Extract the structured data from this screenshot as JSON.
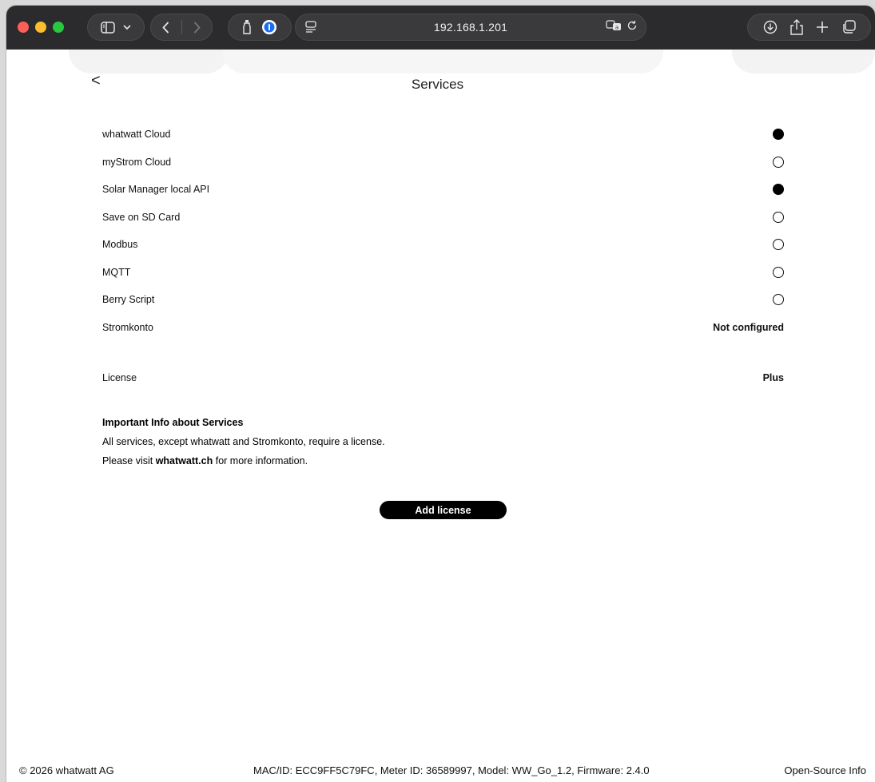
{
  "browser": {
    "address": "192.168.1.201",
    "icons": {
      "sidebar": "sidebar-icon",
      "chevron": "chevron-down-icon",
      "back": "chevron-left-icon",
      "forward": "chevron-right-icon",
      "extension1": "bottle-icon",
      "extension2": "password-manager-icon",
      "reader": "reader-icon",
      "translate": "translate-icon",
      "reload": "reload-icon",
      "download": "download-icon",
      "share": "share-icon",
      "newtab": "plus-icon",
      "tabs": "tabs-overview-icon"
    }
  },
  "page": {
    "back_label": "<",
    "title": "Services",
    "services": [
      {
        "name": "whatwatt Cloud",
        "state": "on"
      },
      {
        "name": "myStrom Cloud",
        "state": "off"
      },
      {
        "name": "Solar Manager local API",
        "state": "on"
      },
      {
        "name": "Save on SD Card",
        "state": "off"
      },
      {
        "name": "Modbus",
        "state": "off"
      },
      {
        "name": "MQTT",
        "state": "off"
      },
      {
        "name": "Berry Script",
        "state": "off"
      }
    ],
    "stromkonto": {
      "name": "Stromkonto",
      "value": "Not configured"
    },
    "license": {
      "name": "License",
      "value": "Plus"
    },
    "info": {
      "title": "Important Info about Services",
      "line1": "All services, except whatwatt and Stromkonto, require a license.",
      "line2_prefix": "Please visit ",
      "line2_link": "whatwatt.ch",
      "line2_suffix": " for more information."
    },
    "add_license_label": "Add license"
  },
  "footer": {
    "copyright": "© 2026 whatwatt AG",
    "device_info": "MAC/ID: ECC9FF5C79FC, Meter ID: 36589997, Model: WW_Go_1.2, Firmware: 2.4.0",
    "open_source": "Open-Source Info"
  }
}
